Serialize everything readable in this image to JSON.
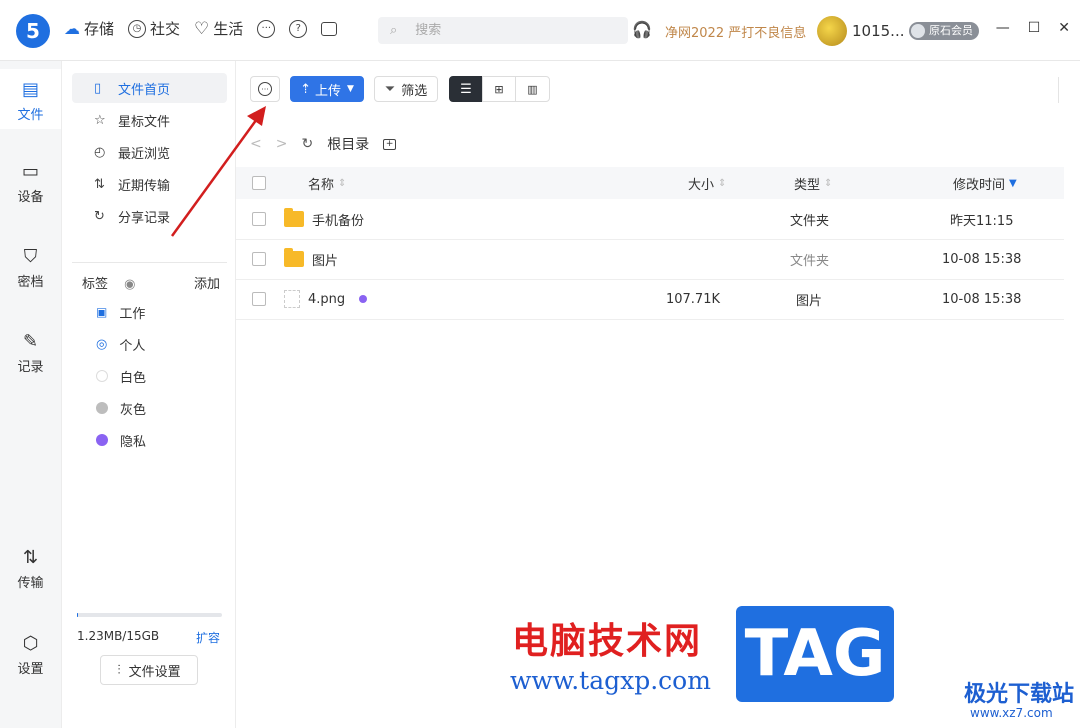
{
  "topbar": {
    "logo": "5",
    "nav": [
      {
        "label": "存储",
        "icon": "cloud-icon"
      },
      {
        "label": "社交",
        "icon": "clock-icon"
      },
      {
        "label": "生活",
        "icon": "heart-icon"
      }
    ],
    "search_placeholder": "搜索",
    "promo": "净网2022 严打不良信息",
    "username": "1015...",
    "member_badge": "原石会员"
  },
  "rail": [
    {
      "label": "文件",
      "icon": "file-icon"
    },
    {
      "label": "设备",
      "icon": "device-icon"
    },
    {
      "label": "密档",
      "icon": "shield-icon"
    },
    {
      "label": "记录",
      "icon": "pencil-icon"
    },
    {
      "label": "传输",
      "icon": "transfer-icon"
    },
    {
      "label": "设置",
      "icon": "settings-icon"
    }
  ],
  "sidebar": {
    "nav": [
      {
        "label": "文件首页",
        "icon": "file-outline-icon"
      },
      {
        "label": "星标文件",
        "icon": "star-icon"
      },
      {
        "label": "最近浏览",
        "icon": "history-icon"
      },
      {
        "label": "近期传输",
        "icon": "transfer-small-icon"
      },
      {
        "label": "分享记录",
        "icon": "share-icon"
      }
    ],
    "tags_title": "标签",
    "tags_add": "添加",
    "tags": [
      {
        "label": "工作",
        "color": "#1f6fe0"
      },
      {
        "label": "个人",
        "color": "#1f6fe0"
      },
      {
        "label": "白色",
        "color": "#ffffff"
      },
      {
        "label": "灰色",
        "color": "#bdbdbd"
      },
      {
        "label": "隐私",
        "color": "#8a63f2"
      }
    ],
    "storage": {
      "text": "1.23MB/15GB",
      "used_fraction": 0.0001,
      "expand": "扩容"
    },
    "file_settings": "文件设置"
  },
  "toolbar": {
    "upload": "上传",
    "filter": "筛选"
  },
  "breadcrumb": {
    "root": "根目录"
  },
  "table": {
    "headers": {
      "name": "名称",
      "size": "大小",
      "type": "类型",
      "modified": "修改时间"
    },
    "rows": [
      {
        "name": "手机备份",
        "size": "",
        "type": "文件夹",
        "modified": "昨天11:15",
        "kind": "folder"
      },
      {
        "name": "图片",
        "size": "",
        "type": "文件夹",
        "modified": "10-08 15:38",
        "kind": "folder"
      },
      {
        "name": "4.png",
        "size": "107.71K",
        "type": "图片",
        "modified": "10-08 15:38",
        "kind": "image"
      }
    ]
  },
  "watermark": {
    "cn": "电脑技术网",
    "url": "www.tagxp.com",
    "tag": "TAG",
    "site": "极光下载站",
    "site_url": "www.xz7.com"
  }
}
